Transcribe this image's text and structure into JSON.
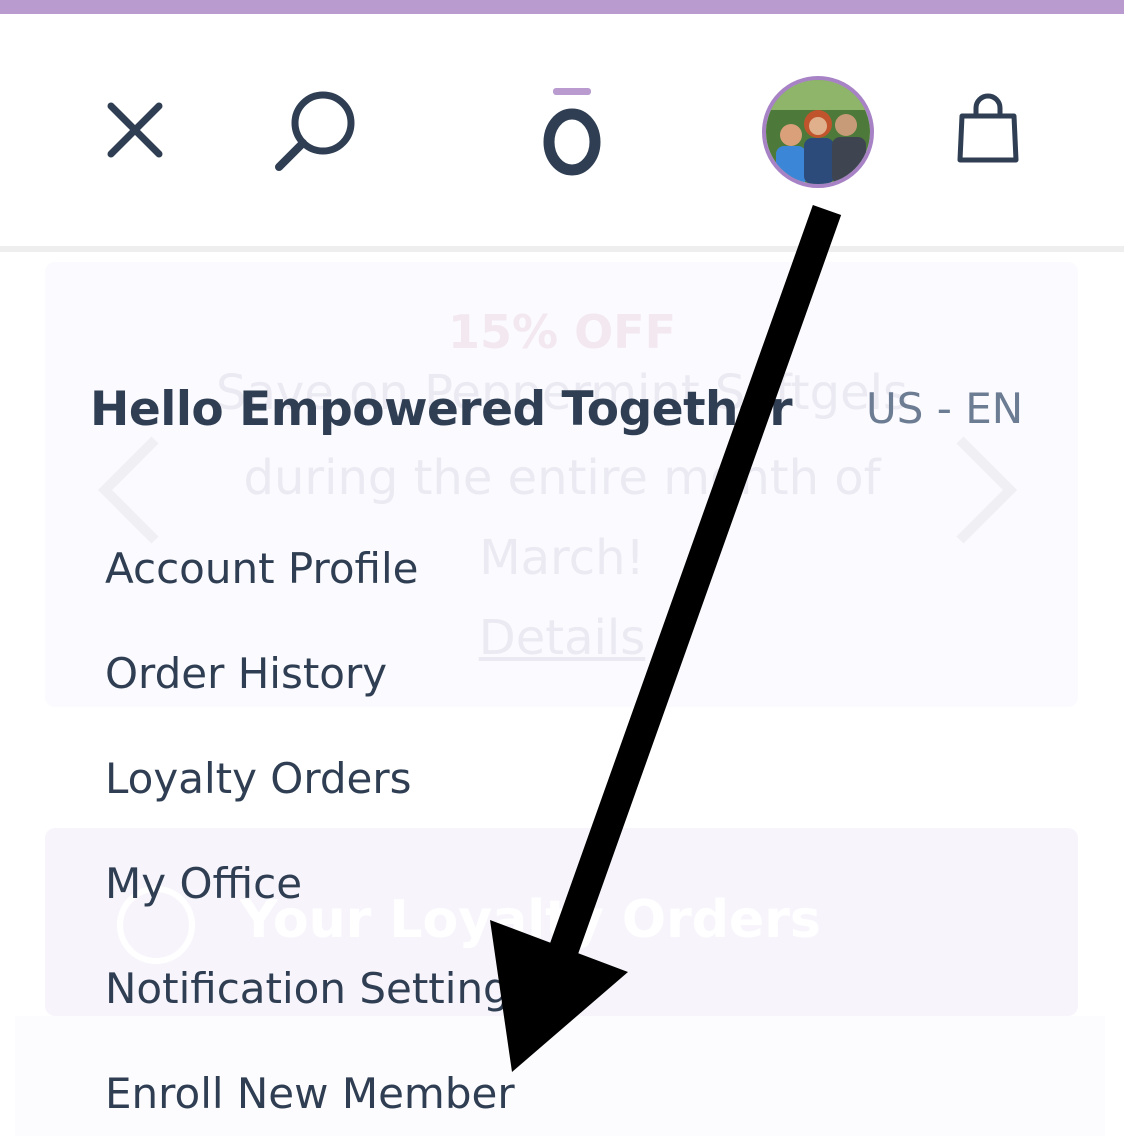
{
  "header": {
    "accent_color": "#b99bd0",
    "icons": [
      "close-icon",
      "search-icon",
      "brand-logo",
      "avatar",
      "shopping-bag-icon"
    ]
  },
  "background": {
    "promo_title": "15% OFF",
    "promo_lines": [
      "Save on Peppermint Softgels",
      "during the entire month of",
      "March!"
    ],
    "promo_link": "Details",
    "loyalty_banner": "Your Loyalty Orders"
  },
  "menu": {
    "greeting": "Hello Empowered Together",
    "locale": "US - EN",
    "items": [
      {
        "label": "Account Profile"
      },
      {
        "label": "Order History"
      },
      {
        "label": "Loyalty Orders"
      },
      {
        "label": "My Office"
      },
      {
        "label": "Notification Settings"
      },
      {
        "label": "Enroll New Member"
      }
    ]
  },
  "annotation": {
    "type": "arrow",
    "color": "#000000",
    "from": "avatar",
    "to": "Enroll New Member"
  }
}
